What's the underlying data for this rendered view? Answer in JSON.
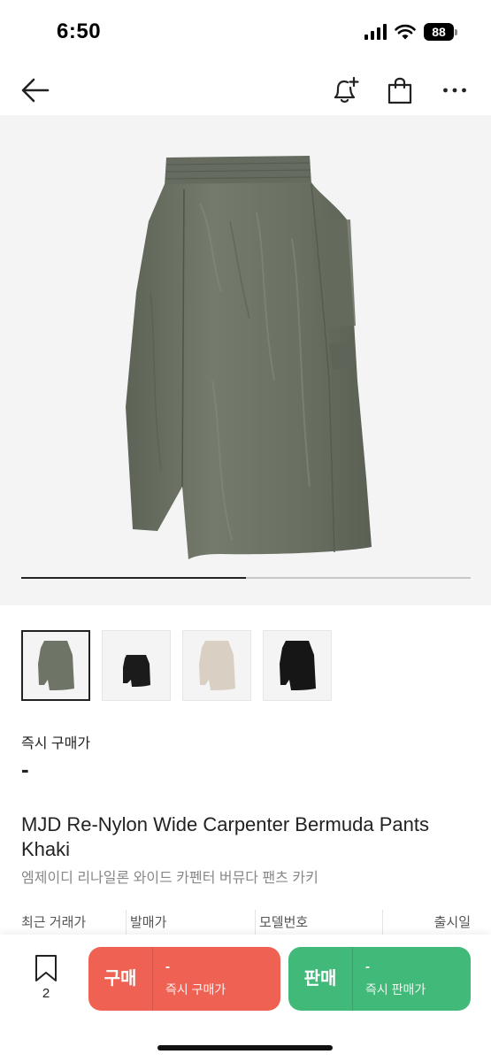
{
  "status_bar": {
    "time": "6:50",
    "battery": "88"
  },
  "hero": {
    "progress": 0.5
  },
  "thumbnails": [
    {
      "color": "#6f7566",
      "selected": true
    },
    {
      "color": "#1b1b1b",
      "selected": false
    },
    {
      "color": "#d9cfc2",
      "selected": false
    },
    {
      "color": "#161616",
      "selected": false
    }
  ],
  "price": {
    "label": "즉시 구매가",
    "value": "-"
  },
  "product": {
    "title_en": "MJD Re-Nylon Wide Carpenter Bermuda Pants Khaki",
    "title_ko": "엠제이디 리나일론 와이드 카펜터 버뮤다 팬츠 카키"
  },
  "info": {
    "recent_price": "최근 거래가",
    "release_price": "발매가",
    "model_number": "모델번호",
    "release_date": "출시일"
  },
  "bottom": {
    "wish_count": "2",
    "buy": {
      "label": "구매",
      "price": "-",
      "desc": "즉시 구매가"
    },
    "sell": {
      "label": "판매",
      "price": "-",
      "desc": "즉시 판매가"
    }
  },
  "colors": {
    "buy": "#ef6253",
    "sell": "#41b979",
    "product": "#6f7566"
  },
  "icons": [
    "back-arrow-icon",
    "bell-plus-icon",
    "shopping-bag-icon",
    "more-icon",
    "bookmark-icon"
  ]
}
